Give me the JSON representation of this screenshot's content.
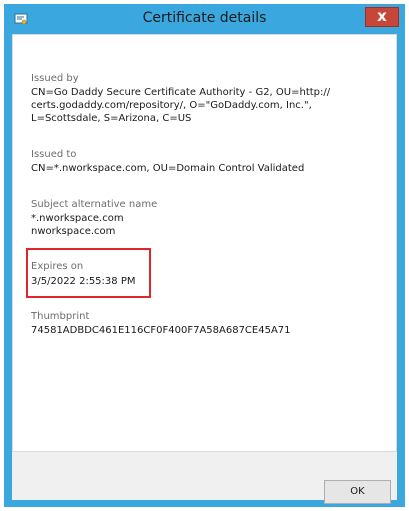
{
  "window": {
    "title": "Certificate details",
    "close_label": "x"
  },
  "fields": {
    "issued_by": {
      "label": "Issued by",
      "lines": [
        "CN=Go Daddy Secure Certificate Authority - G2, OU=http://",
        "certs.godaddy.com/repository/, O=\"GoDaddy.com, Inc.\",",
        "L=Scottsdale, S=Arizona, C=US"
      ]
    },
    "issued_to": {
      "label": "Issued to",
      "value": "CN=*.nworkspace.com, OU=Domain Control Validated"
    },
    "subject_alt_name": {
      "label": "Subject alternative name",
      "lines": [
        "*.nworkspace.com",
        "nworkspace.com"
      ]
    },
    "expires_on": {
      "label": "Expires on",
      "value": "3/5/2022 2:55:38 PM"
    },
    "thumbprint": {
      "label": "Thumbprint",
      "value": "74581ADBDC461E116CF0F400F7A58A687CE45A71"
    }
  },
  "buttons": {
    "ok_label": "OK"
  },
  "colors": {
    "titlebar": "#3aa8df",
    "close_button": "#c7463a",
    "highlight_border": "#e0262b"
  },
  "icons": {
    "title_icon": "certificate-icon",
    "close_icon": "close-icon"
  }
}
